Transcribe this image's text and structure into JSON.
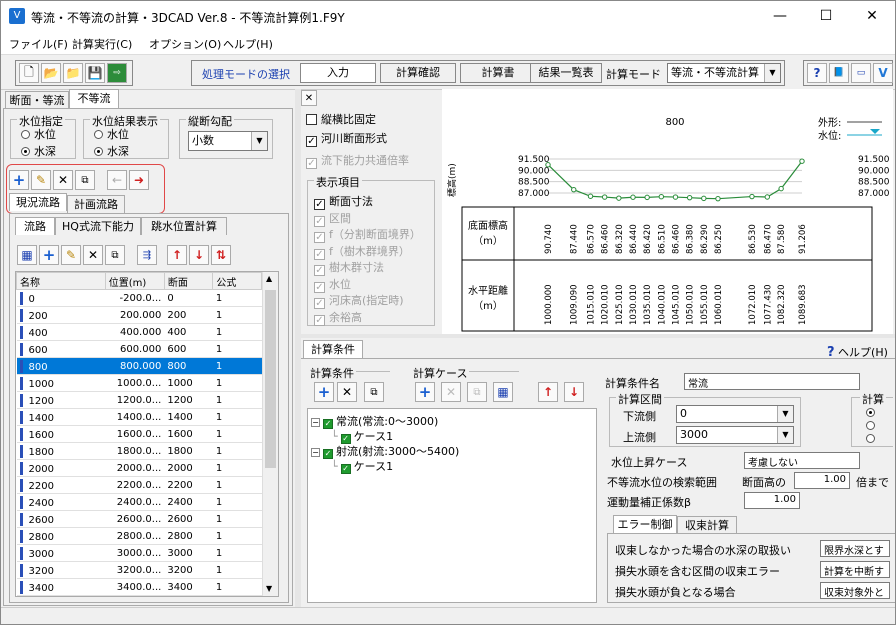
{
  "window": {
    "title": "等流・不等流の計算・3DCAD Ver.8 - 不等流計算例1.F9Y",
    "minimize_glyph": "—",
    "maximize_glyph": "☐",
    "close_glyph": "✕"
  },
  "menu": [
    "ファイル(F)",
    "計算実行(C)",
    "オプション(O)",
    "ヘルプ(H)"
  ],
  "toolbar": {
    "mode_label": "処理モードの選択",
    "modes": [
      "入力",
      "計算確認",
      "計算書",
      "結果一覧表"
    ],
    "calc_mode_label": "計算モード",
    "calc_mode_value": "等流・不等流計算"
  },
  "left": {
    "tabs": [
      "断面・等流",
      "不等流"
    ],
    "water_level_spec": {
      "title": "水位指定",
      "options": [
        "水位",
        "水深"
      ],
      "selected": 1
    },
    "water_level_display": {
      "title": "水位結果表示",
      "options": [
        "水位",
        "水深"
      ],
      "selected": 1
    },
    "vertical_slope": {
      "title": "縦断勾配",
      "value": "小数"
    },
    "channel_tabs": [
      "現況流路",
      "計画流路"
    ],
    "sub_tabs": [
      "流路",
      "HQ式流下能力",
      "跳水位置計算"
    ],
    "table": {
      "headers": [
        "名称",
        "位置(m)",
        "断面",
        "公式"
      ],
      "rows": [
        [
          "0",
          "-200.0...",
          "0",
          "1"
        ],
        [
          "200",
          "200.000",
          "200",
          "1"
        ],
        [
          "400",
          "400.000",
          "400",
          "1"
        ],
        [
          "600",
          "600.000",
          "600",
          "1"
        ],
        [
          "800",
          "800.000",
          "800",
          "1"
        ],
        [
          "1000",
          "1000.0...",
          "1000",
          "1"
        ],
        [
          "1200",
          "1200.0...",
          "1200",
          "1"
        ],
        [
          "1400",
          "1400.0...",
          "1400",
          "1"
        ],
        [
          "1600",
          "1600.0...",
          "1600",
          "1"
        ],
        [
          "1800",
          "1800.0...",
          "1800",
          "1"
        ],
        [
          "2000",
          "2000.0...",
          "2000",
          "1"
        ],
        [
          "2200",
          "2200.0...",
          "2200",
          "1"
        ],
        [
          "2400",
          "2400.0...",
          "2400",
          "1"
        ],
        [
          "2600",
          "2600.0...",
          "2600",
          "1"
        ],
        [
          "2800",
          "2800.0...",
          "2800",
          "1"
        ],
        [
          "3000",
          "3000.0...",
          "3000",
          "1"
        ],
        [
          "3200",
          "3200.0...",
          "3200",
          "1"
        ],
        [
          "3400",
          "3400.0...",
          "3400",
          "1"
        ]
      ],
      "selected_row": 4
    }
  },
  "view_options": {
    "close_glyph": "✕",
    "aspect_fixed": "縦横比固定",
    "river_section": "河川断面形式",
    "flow_capacity": "流下能力共通倍率",
    "display_items_title": "表示項目",
    "display_items": [
      "断面寸法",
      "区間",
      "f（分割断面境界）",
      "f（樹木群境界）",
      "樹木群寸法",
      "水位",
      "河床高(指定時)",
      "余裕高"
    ]
  },
  "section_view": {
    "title": "800",
    "legend": [
      "外形:",
      "水位:"
    ],
    "y_axis_label": "標高(m)",
    "y_ticks": [
      "91.500",
      "90.000",
      "88.500",
      "87.000"
    ],
    "right_ticks": [
      "91.500",
      "90.000",
      "88.500",
      "87.000"
    ],
    "row1_label": "底面標高\n（m）",
    "row2_label": "水平距離\n（m）",
    "elevations": [
      "90.740",
      "87.440",
      "86.570",
      "86.460",
      "86.320",
      "86.440",
      "86.420",
      "86.510",
      "86.460",
      "86.380",
      "86.290",
      "86.250",
      "86.530",
      "86.470",
      "87.580",
      "91.206"
    ],
    "distances": [
      "1000.000",
      "1009.090",
      "1015.010",
      "1020.010",
      "1025.010",
      "1030.010",
      "1035.010",
      "1040.010",
      "1045.010",
      "1050.010",
      "1055.010",
      "1060.010",
      "1072.010",
      "1077.430",
      "1082.320",
      "1089.683"
    ]
  },
  "calc_conditions": {
    "tab": "計算条件",
    "help_label": "ヘルプ(H)",
    "conditions_title": "計算条件",
    "cases_title": "計算ケース",
    "tree": [
      {
        "label": "常流(常流:0〜3000)",
        "children": [
          "ケース1"
        ]
      },
      {
        "label": "射流(射流:3000〜5400)",
        "children": [
          "ケース1"
        ]
      }
    ],
    "name_label": "計算条件名",
    "name_value": "常流",
    "section_title": "計算区間",
    "downstream_label": "下流側",
    "downstream_value": "0",
    "upstream_label": "上流側",
    "upstream_value": "3000",
    "calc_right_title": "計算",
    "rise_case_label": "水位上昇ケース",
    "rise_case_value": "考慮しない",
    "search_range_label": "不等流水位の検索範囲",
    "search_range_sub": "断面高の",
    "search_range_value": "1.00",
    "search_range_unit": "倍まで",
    "momentum_label": "運動量補正係数β",
    "momentum_value": "1.00",
    "err_tabs": [
      "エラー制御",
      "収束計算"
    ],
    "err_rows": [
      {
        "label": "収束しなかった場合の水深の取扱い",
        "value": "限界水深とす"
      },
      {
        "label": "損失水頭を含む区間の収束エラー",
        "value": "計算を中断す"
      },
      {
        "label": "損失水頭が負となる場合",
        "value": "収束対象外と"
      }
    ]
  }
}
